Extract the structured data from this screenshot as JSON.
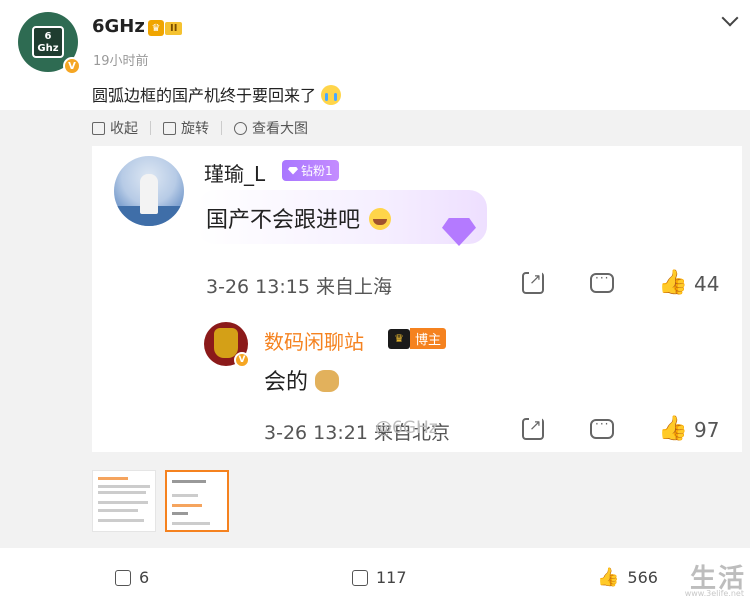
{
  "post": {
    "author": "6GHz",
    "avatar_text": "6\nGhz",
    "level": "II",
    "time": "19小时前",
    "text": "圆弧边框的国产机终于要回来了"
  },
  "toolbar": {
    "collapse": "收起",
    "rotate": "旋转",
    "view_large": "查看大图"
  },
  "comment1": {
    "author": "瑾瑜_L",
    "fan_badge": "钻粉1",
    "text": "国产不会跟进吧",
    "datetime": "3-26 13:15",
    "location": "来自上海",
    "likes": "44"
  },
  "comment2": {
    "author": "数码闲聊站",
    "badge": "博主",
    "text": "会的",
    "datetime": "3-26 13:21",
    "location": "来自北京",
    "likes": "97",
    "watermark": "@6GHz"
  },
  "actions": {
    "reposts": "6",
    "comments": "117",
    "likes": "566"
  },
  "site": {
    "logo": "生活",
    "url": "www.3elife.net"
  },
  "colors": {
    "orange": "#f5821f",
    "purple": "#b47aff",
    "gray_bg": "#f2f2f2"
  }
}
